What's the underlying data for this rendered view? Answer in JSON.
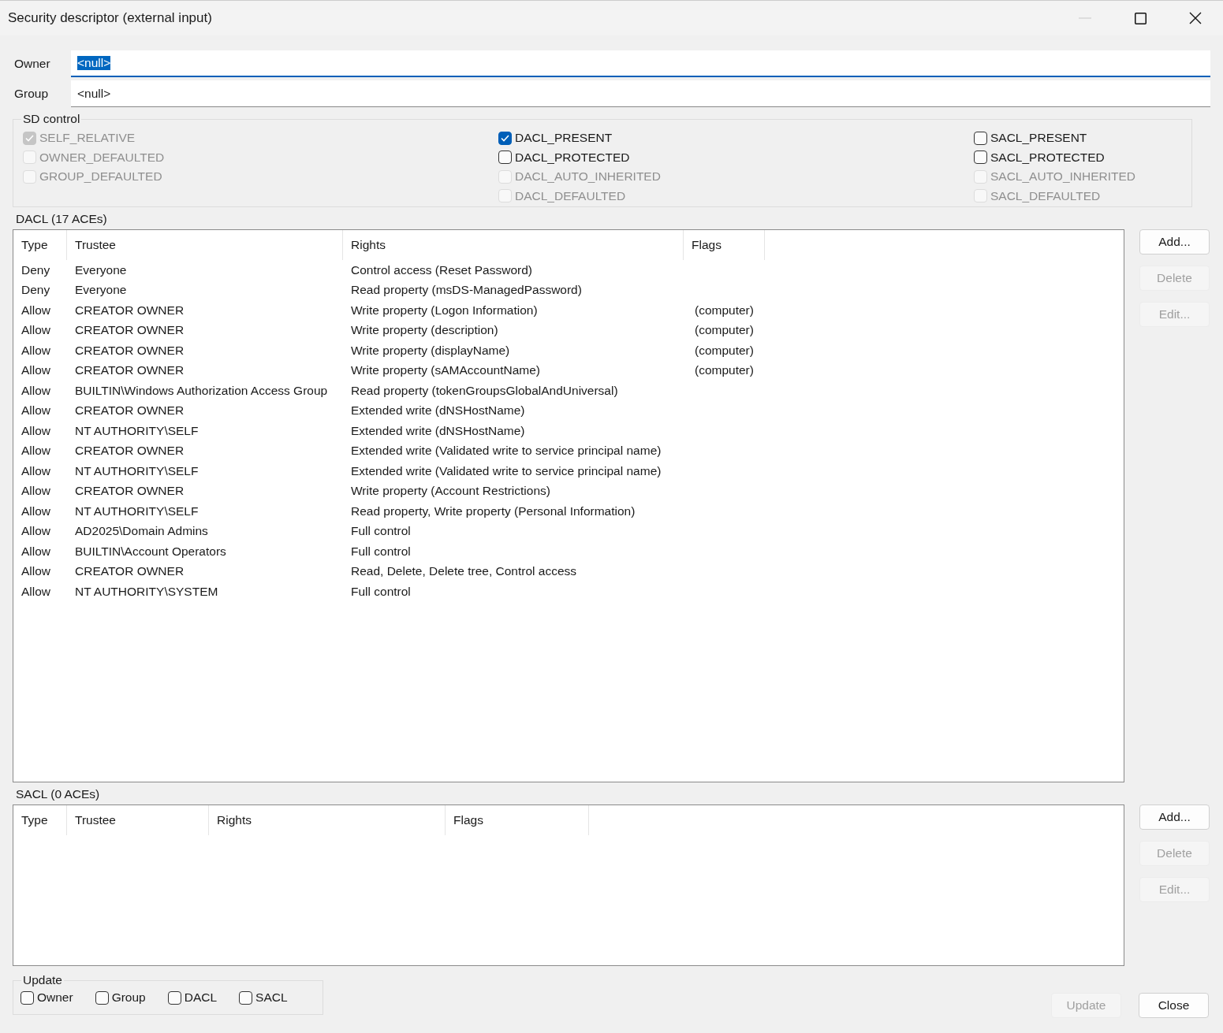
{
  "window": {
    "title": "Security descriptor (external input)"
  },
  "fields": [
    {
      "label": "Owner",
      "value": "<null>",
      "focused": true
    },
    {
      "label": "Group",
      "value": "<null>",
      "focused": false
    }
  ],
  "sd_control": {
    "title": "SD control",
    "columns": [
      [
        {
          "label": "SELF_RELATIVE",
          "checked": true,
          "disabled": true
        },
        {
          "label": "OWNER_DEFAULTED",
          "checked": false,
          "disabled": true
        },
        {
          "label": "GROUP_DEFAULTED",
          "checked": false,
          "disabled": true
        }
      ],
      [
        {
          "label": "DACL_PRESENT",
          "checked": true,
          "disabled": false
        },
        {
          "label": "DACL_PROTECTED",
          "checked": false,
          "disabled": false
        },
        {
          "label": "DACL_AUTO_INHERITED",
          "checked": false,
          "disabled": true
        },
        {
          "label": "DACL_DEFAULTED",
          "checked": false,
          "disabled": true
        }
      ],
      [
        {
          "label": "SACL_PRESENT",
          "checked": false,
          "disabled": false
        },
        {
          "label": "SACL_PROTECTED",
          "checked": false,
          "disabled": false
        },
        {
          "label": "SACL_AUTO_INHERITED",
          "checked": false,
          "disabled": true
        },
        {
          "label": "SACL_DEFAULTED",
          "checked": false,
          "disabled": true
        }
      ]
    ]
  },
  "dacl": {
    "title": "DACL (17 ACEs)",
    "columns": [
      "Type",
      "Trustee",
      "Rights",
      "Flags"
    ],
    "rows": [
      {
        "type": "Deny",
        "trustee": "Everyone",
        "rights": "Control access (Reset Password)"
      },
      {
        "type": "Deny",
        "trustee": "Everyone",
        "rights": "Read property (msDS-ManagedPassword)"
      },
      {
        "type": "Allow",
        "trustee": "CREATOR OWNER",
        "rights": "Write property (Logon Information)",
        "flags": "(computer)"
      },
      {
        "type": "Allow",
        "trustee": "CREATOR OWNER",
        "rights": "Write property (description)",
        "flags": "(computer)"
      },
      {
        "type": "Allow",
        "trustee": "CREATOR OWNER",
        "rights": "Write property (displayName)",
        "flags": "(computer)"
      },
      {
        "type": "Allow",
        "trustee": "CREATOR OWNER",
        "rights": "Write property (sAMAccountName)",
        "flags": "(computer)"
      },
      {
        "type": "Allow",
        "trustee": "BUILTIN\\Windows Authorization Access Group",
        "rights": "Read property (tokenGroupsGlobalAndUniversal)"
      },
      {
        "type": "Allow",
        "trustee": "CREATOR OWNER",
        "rights": "Extended write (dNSHostName)"
      },
      {
        "type": "Allow",
        "trustee": "NT AUTHORITY\\SELF",
        "rights": "Extended write (dNSHostName)"
      },
      {
        "type": "Allow",
        "trustee": "CREATOR OWNER",
        "rights": "Extended write (Validated write to service principal name)"
      },
      {
        "type": "Allow",
        "trustee": "NT AUTHORITY\\SELF",
        "rights": "Extended write (Validated write to service principal name)"
      },
      {
        "type": "Allow",
        "trustee": "CREATOR OWNER",
        "rights": "Write property (Account Restrictions)"
      },
      {
        "type": "Allow",
        "trustee": "NT AUTHORITY\\SELF",
        "rights": "Read property, Write property (Personal Information)"
      },
      {
        "type": "Allow",
        "trustee": "AD2025\\Domain Admins",
        "rights": "Full control"
      },
      {
        "type": "Allow",
        "trustee": "BUILTIN\\Account Operators",
        "rights": "Full control"
      },
      {
        "type": "Allow",
        "trustee": "CREATOR OWNER",
        "rights": "Read, Delete, Delete tree, Control access"
      },
      {
        "type": "Allow",
        "trustee": "NT AUTHORITY\\SYSTEM",
        "rights": "Full control"
      }
    ],
    "buttons": [
      {
        "label": "Add...",
        "disabled": false
      },
      {
        "label": "Delete",
        "disabled": true
      },
      {
        "label": "Edit...",
        "disabled": true
      }
    ]
  },
  "sacl": {
    "title": "SACL (0 ACEs)",
    "columns": [
      "Type",
      "Trustee",
      "Rights",
      "Flags"
    ],
    "buttons": [
      {
        "label": "Add...",
        "disabled": false
      },
      {
        "label": "Delete",
        "disabled": true
      },
      {
        "label": "Edit...",
        "disabled": true
      }
    ]
  },
  "update": {
    "title": "Update",
    "options": [
      {
        "label": "Owner",
        "checked": false
      },
      {
        "label": "Group",
        "checked": false
      },
      {
        "label": "DACL",
        "checked": false
      },
      {
        "label": "SACL",
        "checked": false
      }
    ]
  },
  "buttons": [
    {
      "label": "Update",
      "disabled": true
    },
    {
      "label": "Close",
      "disabled": false
    }
  ]
}
